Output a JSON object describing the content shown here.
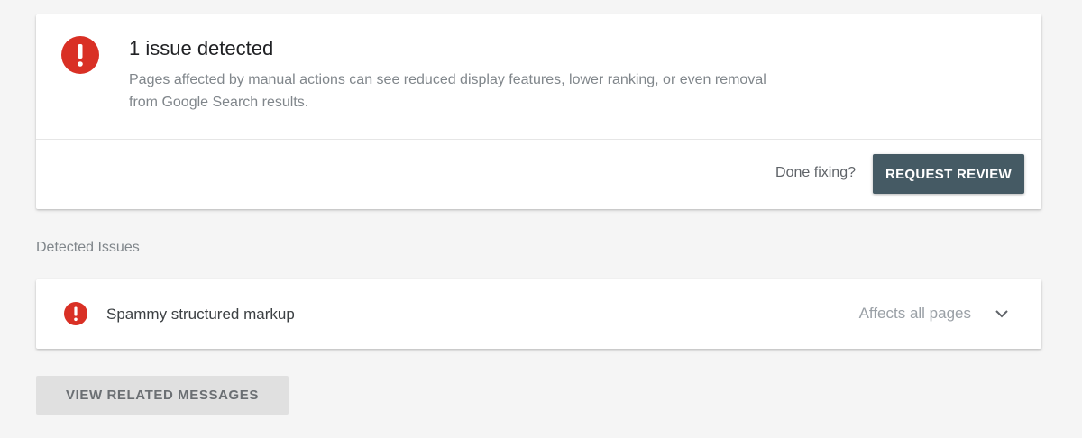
{
  "colors": {
    "error": "#d93025",
    "primary_button": "#455a64",
    "secondary_button": "#e0e0e0",
    "background": "#f5f5f5"
  },
  "summary": {
    "icon": "error-icon",
    "title": "1 issue detected",
    "description": "Pages affected by manual actions can see reduced display features, lower ranking, or even removal from Google Search results.",
    "done_fixing_label": "Done fixing?",
    "request_review_label": "REQUEST REVIEW"
  },
  "detected_issues": {
    "label": "Detected Issues",
    "items": [
      {
        "icon": "error-icon",
        "name": "Spammy structured markup",
        "scope": "Affects all pages",
        "expand_icon": "chevron-down-icon"
      }
    ]
  },
  "footer": {
    "view_related_messages_label": "VIEW RELATED MESSAGES"
  }
}
